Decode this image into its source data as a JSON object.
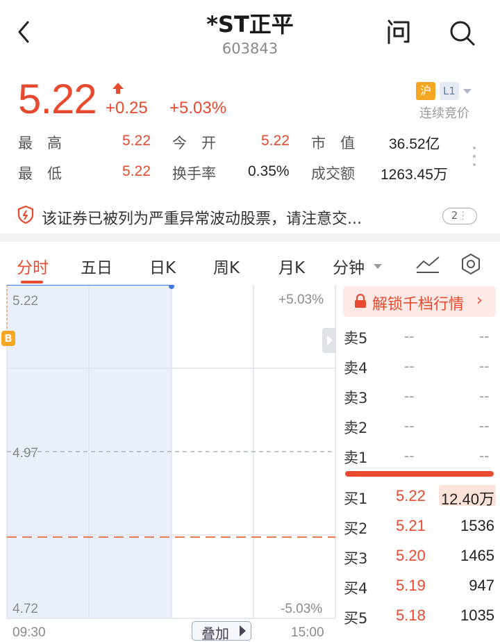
{
  "header": {
    "title": "*ST正平",
    "code": "603843"
  },
  "quote": {
    "price": "5.22",
    "change": "+0.25",
    "change_pct": "+5.03%",
    "exchange_badge": "沪",
    "level_badge": "L1",
    "status": "连续竞价",
    "stats": {
      "high_label": "最　高",
      "high": "5.22",
      "open_label": "今　开",
      "open": "5.22",
      "mcap_label": "市　值",
      "mcap": "36.52亿",
      "low_label": "最　低",
      "low": "5.22",
      "turnover_label": "换手率",
      "turnover": "0.35%",
      "amount_label": "成交额",
      "amount": "1263.45万"
    }
  },
  "alert": {
    "text": "该证券已被列为严重异常波动股票，请注意交...",
    "badge": "2"
  },
  "tabs": [
    "分时",
    "五日",
    "日K",
    "周K",
    "月K",
    "分钟"
  ],
  "chart": {
    "price_high": "5.22",
    "pct_high": "+5.03%",
    "price_mid": "4.97",
    "price_low": "4.72",
    "pct_low": "-5.03%",
    "time_start": "09:30",
    "time_end": "15:00",
    "overlay_label": "叠加",
    "marker": "B"
  },
  "chart_data": {
    "type": "line",
    "x": [
      "09:30",
      "15:00"
    ],
    "ylim": [
      4.72,
      5.22
    ],
    "y_reference": 4.97,
    "series": [
      {
        "values": [
          5.22,
          5.22
        ]
      }
    ]
  },
  "orderbook": {
    "unlock_label": "解锁千档行情",
    "asks": [
      {
        "label": "卖5",
        "price": "--",
        "volume": "--"
      },
      {
        "label": "卖4",
        "price": "--",
        "volume": "--"
      },
      {
        "label": "卖3",
        "price": "--",
        "volume": "--"
      },
      {
        "label": "卖2",
        "price": "--",
        "volume": "--"
      },
      {
        "label": "卖1",
        "price": "--",
        "volume": "--"
      }
    ],
    "bids": [
      {
        "label": "买1",
        "price": "5.22",
        "volume": "12.40万"
      },
      {
        "label": "买2",
        "price": "5.21",
        "volume": "1536"
      },
      {
        "label": "买3",
        "price": "5.20",
        "volume": "1465"
      },
      {
        "label": "买4",
        "price": "5.19",
        "volume": "947"
      },
      {
        "label": "买5",
        "price": "5.18",
        "volume": "1035"
      }
    ]
  },
  "colors": {
    "up": "#e84a2f",
    "accent_orange": "#f5a623",
    "grid": "#dfe3ea",
    "shade": "#e9f0fb"
  },
  "icons": [
    "back-icon",
    "ask-icon",
    "search-icon",
    "alert-shield-icon",
    "trend-line-icon",
    "hexagon-settings-icon",
    "lock-icon"
  ]
}
